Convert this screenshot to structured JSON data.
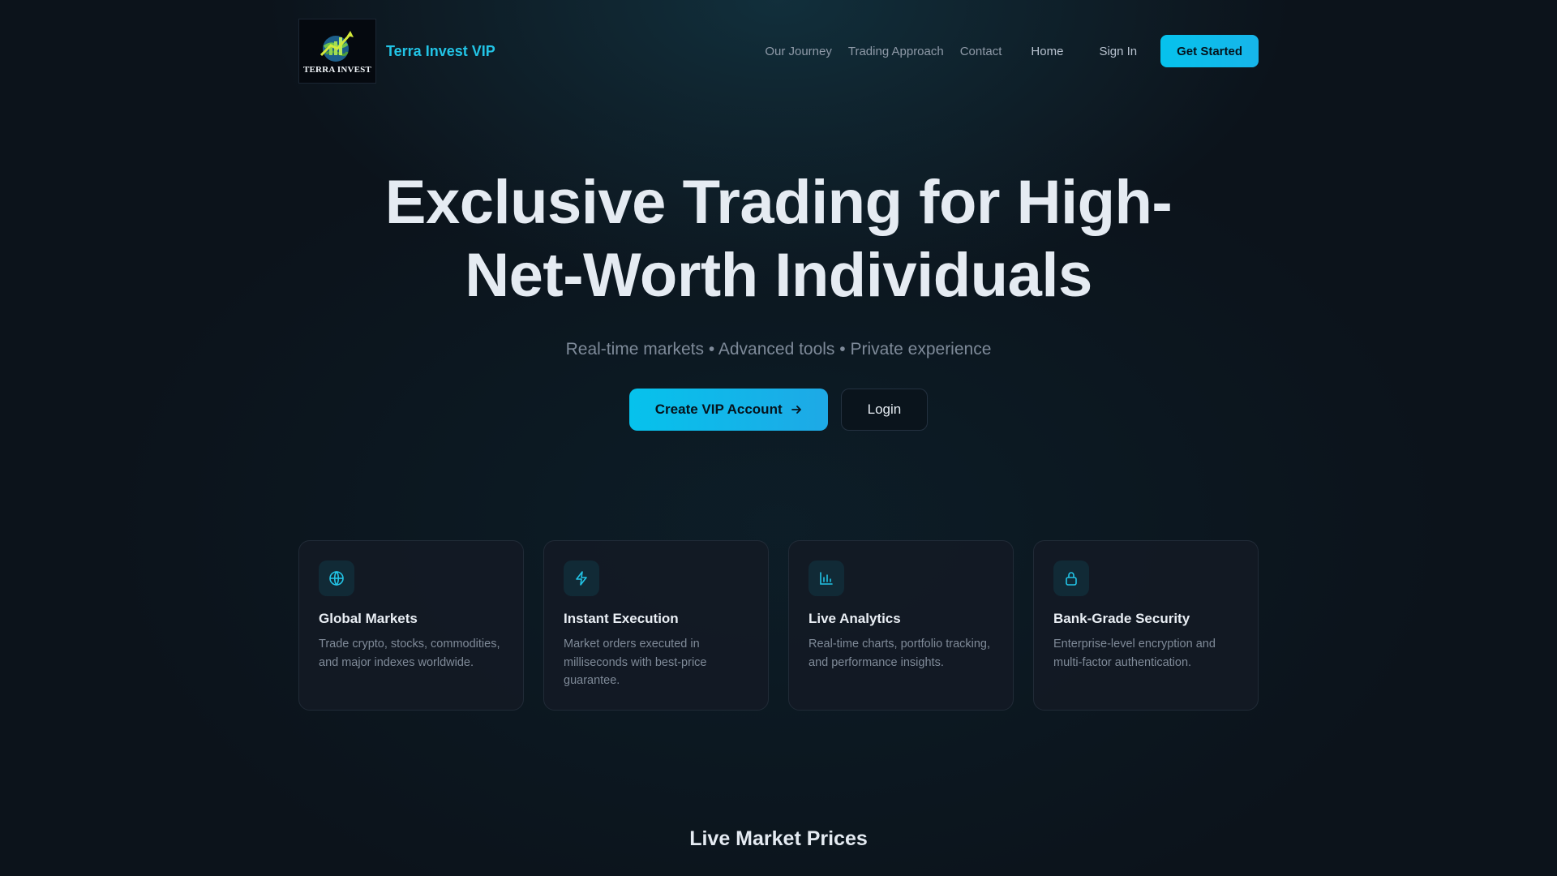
{
  "brand": {
    "logo_text": "TERRA INVEST",
    "name": "Terra Invest VIP"
  },
  "nav": {
    "links": [
      "Our Journey",
      "Trading Approach",
      "Contact"
    ],
    "home": "Home",
    "sign_in": "Sign In",
    "get_started": "Get Started"
  },
  "hero": {
    "title": "Exclusive Trading for High-Net-Worth Individuals",
    "subtitle": "Real-time markets • Advanced tools • Private experience",
    "primary_cta": "Create VIP Account",
    "secondary_cta": "Login"
  },
  "features": [
    {
      "icon": "globe-icon",
      "title": "Global Markets",
      "desc": "Trade crypto, stocks, commodities, and major indexes worldwide."
    },
    {
      "icon": "lightning-icon",
      "title": "Instant Execution",
      "desc": "Market orders executed in milliseconds with best-price guarantee."
    },
    {
      "icon": "bar-chart-icon",
      "title": "Live Analytics",
      "desc": "Real-time charts, portfolio tracking, and performance insights."
    },
    {
      "icon": "lock-icon",
      "title": "Bank-Grade Security",
      "desc": "Enterprise-level encryption and multi-factor authentication."
    }
  ],
  "market_section": {
    "title": "Live Market Prices"
  },
  "colors": {
    "accent": "#06c2ec",
    "brand_text": "#22c4e6",
    "background": "#0c131b"
  }
}
